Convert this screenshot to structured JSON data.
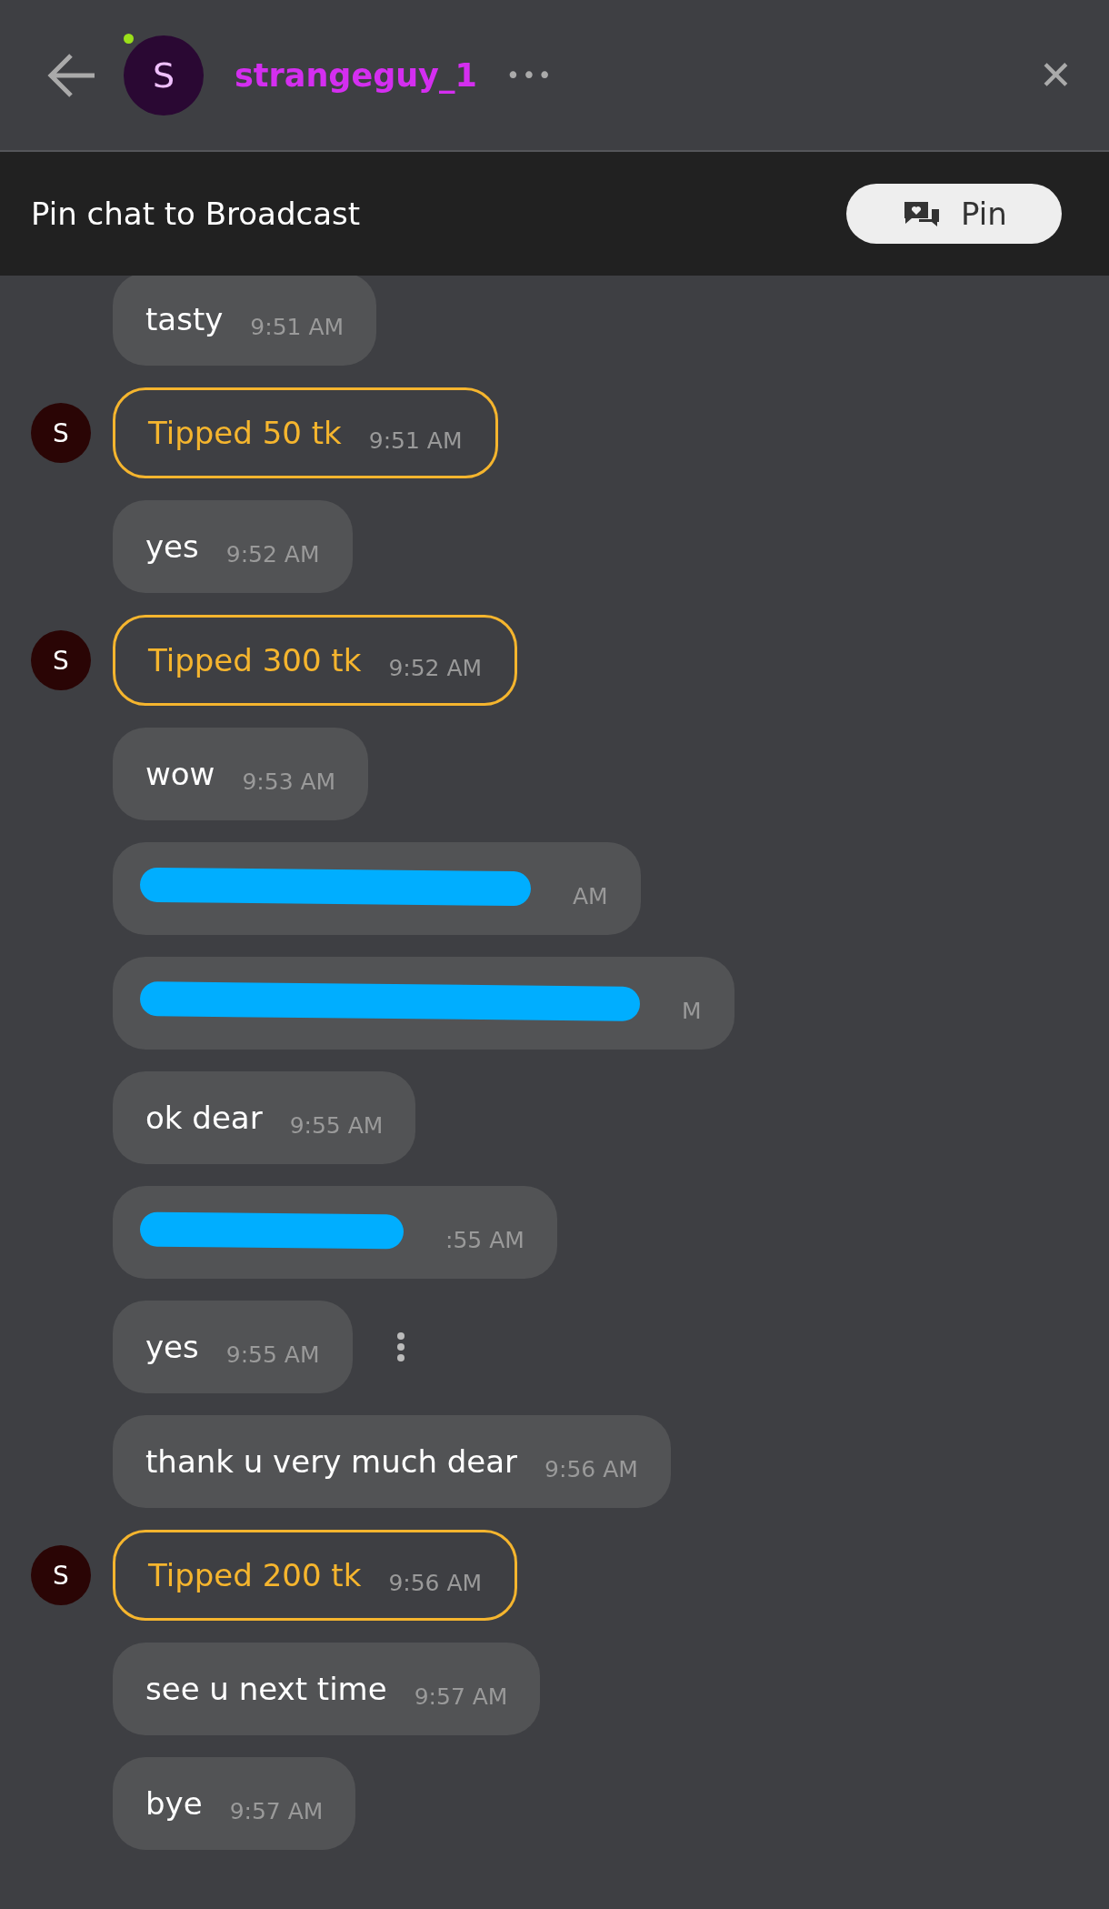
{
  "header": {
    "avatar_letter": "S",
    "online": true,
    "username": "strangeguy_1",
    "more": "•••",
    "close": "✕"
  },
  "pin_bar": {
    "label": "Pin chat to Broadcast",
    "button": "Pin"
  },
  "messages": [
    {
      "kind": "text",
      "text": "tasty",
      "time": "9:51 AM"
    },
    {
      "kind": "tip",
      "avatar_letter": "S",
      "text": "Tipped 50 tk",
      "time": "9:51 AM"
    },
    {
      "kind": "text",
      "text": "yes",
      "time": "9:52 AM"
    },
    {
      "kind": "tip",
      "avatar_letter": "S",
      "text": "Tipped 300 tk",
      "time": "9:52 AM"
    },
    {
      "kind": "text",
      "text": "wow",
      "time": "9:53 AM"
    },
    {
      "kind": "redacted",
      "time": "AM"
    },
    {
      "kind": "redacted",
      "time": "M"
    },
    {
      "kind": "text",
      "text": "ok dear",
      "time": "9:55 AM"
    },
    {
      "kind": "redacted",
      "time": ":55 AM"
    },
    {
      "kind": "text",
      "text": "yes",
      "time": "9:55 AM",
      "menu": true
    },
    {
      "kind": "text",
      "text": "thank u very much dear",
      "time": "9:56 AM"
    },
    {
      "kind": "tip",
      "avatar_letter": "S",
      "text": "Tipped 200 tk",
      "time": "9:56 AM"
    },
    {
      "kind": "text",
      "text": "see u next time",
      "time": "9:57 AM"
    },
    {
      "kind": "text",
      "text": "bye",
      "time": "9:57 AM"
    }
  ]
}
